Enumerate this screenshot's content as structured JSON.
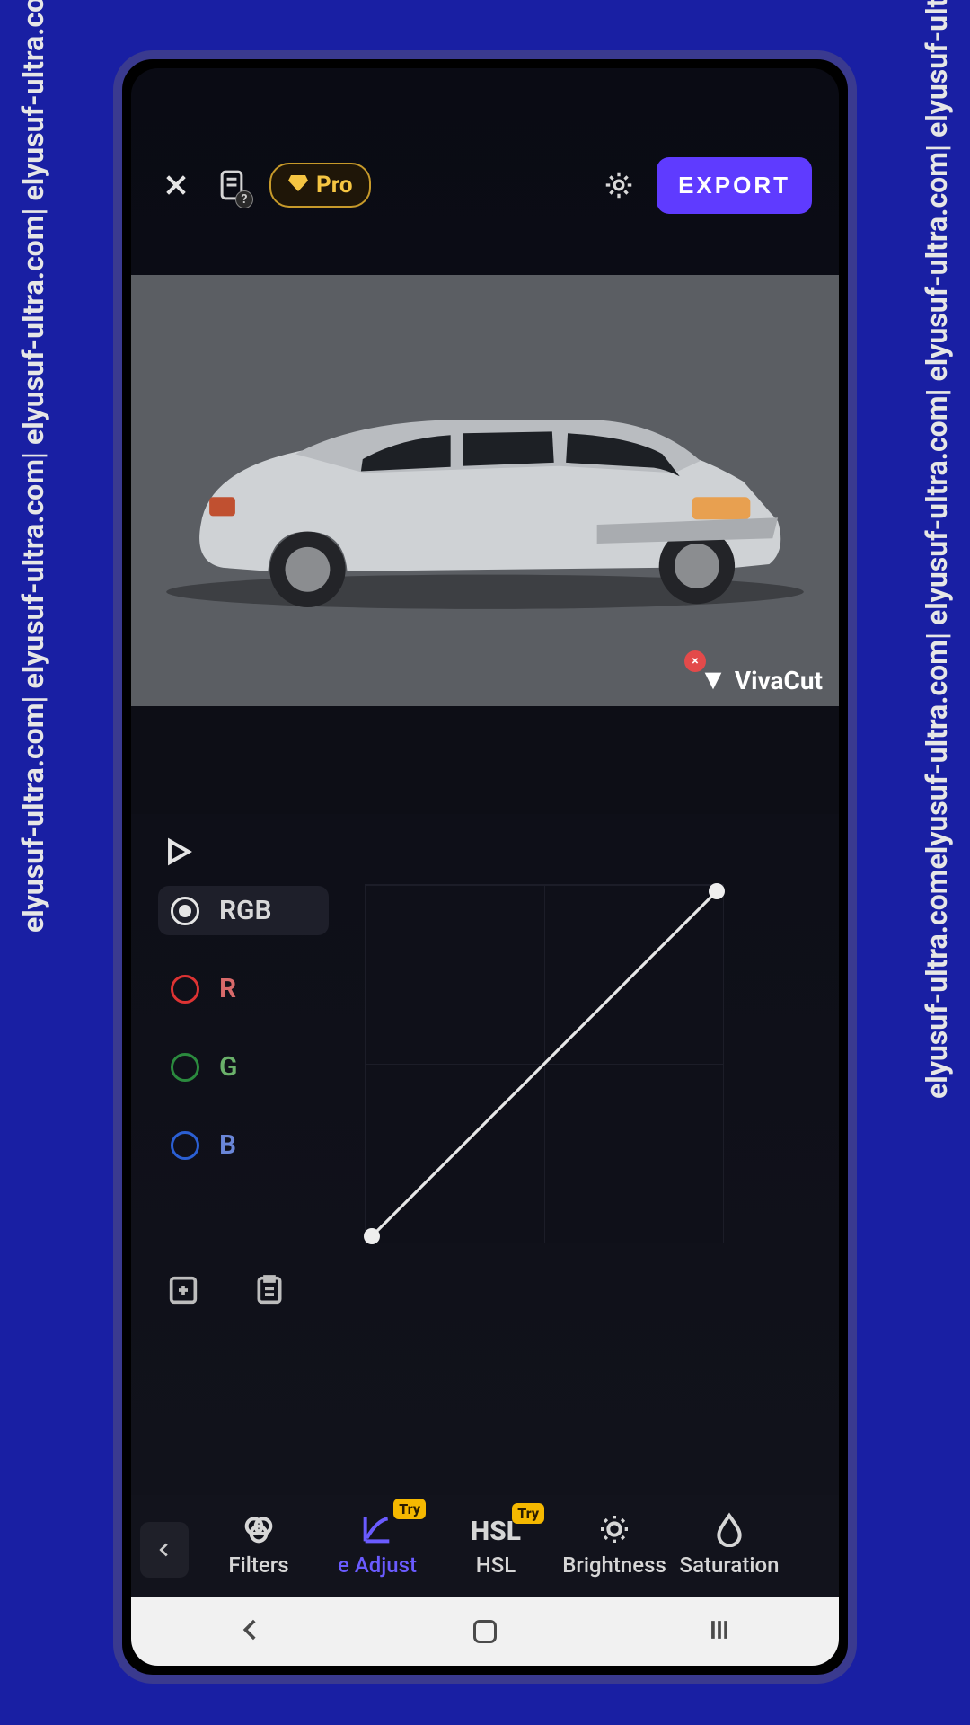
{
  "watermark_site": "elyusuf-ultra.com| elyusuf-ultra.com| elyusuf-ultra.com| elyusuf-ultra.com|",
  "watermark_site_right": "elyusuf-ultra.comelyusuf-ultra.com| elyusuf-ultra.com| elyusuf-ultra.com| elyusuf-ultra.",
  "topbar": {
    "pro_label": "Pro",
    "export_label": "EXPORT",
    "help_badge": "?"
  },
  "watermark": {
    "app_name": "VivaCut",
    "close_glyph": "×"
  },
  "channels": {
    "rgb": "RGB",
    "r": "R",
    "g": "G",
    "b": "B"
  },
  "tools": {
    "filters": "Filters",
    "adjust": "e Adjust",
    "hsl": "HSL",
    "brightness": "Brightness",
    "saturation": "Saturation",
    "try_badge": "Try"
  }
}
